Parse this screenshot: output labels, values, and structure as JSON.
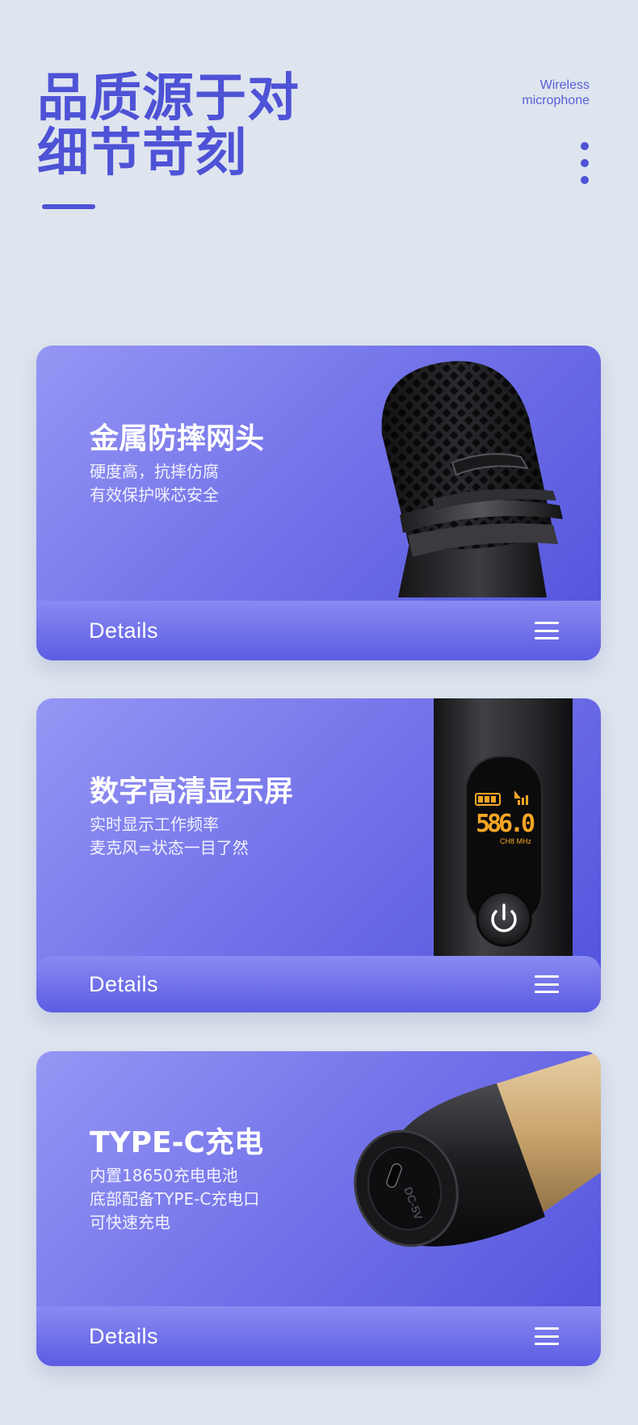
{
  "header": {
    "title_line1": "品质源于对",
    "title_line2": "细节苛刻",
    "brand_line1": "Wireless",
    "brand_line2": "microphone"
  },
  "cards": [
    {
      "title": "金属防摔网头",
      "desc_lines": [
        "硬度高，抗摔仿腐",
        "有效保护咪芯安全"
      ],
      "details_label": "Details",
      "image": "microphone-mesh-grille"
    },
    {
      "title": "数字高清显示屏",
      "desc_lines": [
        "实时显示工作频率",
        "麦克风=状态一目了然"
      ],
      "details_label": "Details",
      "image": "microphone-display-screen",
      "display": {
        "frequency": "586.0",
        "sub": "CH8 MHz"
      }
    },
    {
      "title": "TYPE-C充电",
      "desc_lines": [
        "内置18650充电电池",
        "底部配备TYPE-C充电口",
        "可快速充电"
      ],
      "details_label": "Details",
      "image": "microphone-typec-port",
      "port_label": "DC-5V"
    }
  ],
  "colors": {
    "page_bg": "#dee5ee",
    "accent": "#4e52d6",
    "card_gradient_start": "#9596f4",
    "card_gradient_end": "#5052dc",
    "lcd_orange": "#f5a623"
  }
}
